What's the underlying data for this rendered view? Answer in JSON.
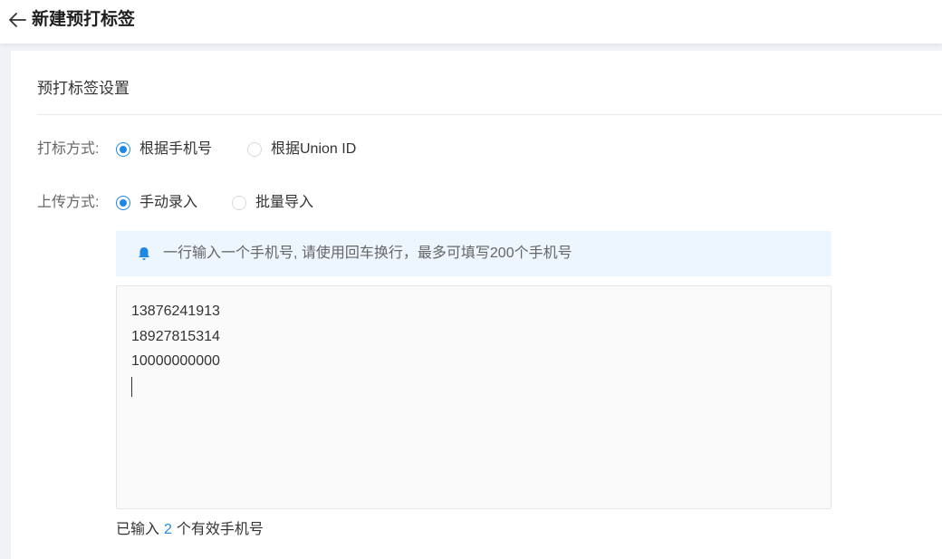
{
  "header": {
    "title": "新建预打标签",
    "back_icon": "arrow-left-icon"
  },
  "section": {
    "title": "预打标签设置"
  },
  "tag_method": {
    "label": "打标方式:",
    "options": [
      {
        "label": "根据手机号",
        "checked": true
      },
      {
        "label": "根据Union ID",
        "checked": false
      }
    ]
  },
  "upload_method": {
    "label": "上传方式:",
    "options": [
      {
        "label": "手动录入",
        "checked": true
      },
      {
        "label": "批量导入",
        "checked": false
      }
    ]
  },
  "notice": {
    "icon": "bell-icon",
    "text": "一行输入一个手机号, 请使用回车换行，最多可填写200个手机号"
  },
  "phone_input": {
    "lines": [
      "13876241913",
      "18927815314",
      "10000000000"
    ]
  },
  "summary": {
    "prefix": "已输入",
    "count": "2",
    "suffix": "个有效手机号"
  },
  "colors": {
    "accent": "#1e88e5",
    "notice_bg": "#edf5ff",
    "page_bg": "#f0f2f5"
  }
}
